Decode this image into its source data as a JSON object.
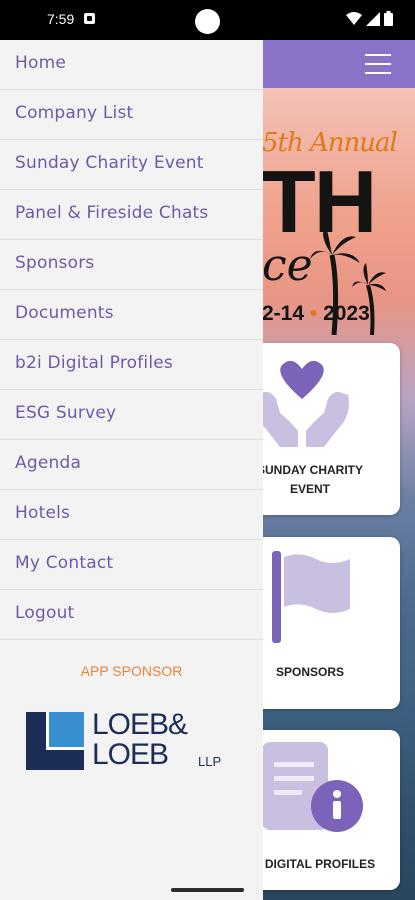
{
  "status_bar": {
    "time": "7:59"
  },
  "drawer": {
    "items": [
      {
        "label": "Home"
      },
      {
        "label": "Company List"
      },
      {
        "label": "Sunday Charity Event"
      },
      {
        "label": "Panel & Fireside Chats"
      },
      {
        "label": "Sponsors"
      },
      {
        "label": "Documents"
      },
      {
        "label": "b2i Digital Profiles"
      },
      {
        "label": "ESG Survey"
      },
      {
        "label": "Agenda"
      },
      {
        "label": "Hotels"
      },
      {
        "label": "My Contact"
      },
      {
        "label": "Logout"
      }
    ],
    "sponsor_label": "APP SPONSOR",
    "sponsor_logo": {
      "line1": "LOEB&",
      "line2": "LOEB",
      "suffix": "LLP"
    }
  },
  "banner": {
    "annual": "5th Annual",
    "big": "TH",
    "script": "ce",
    "dates": "2-14",
    "year": "2023"
  },
  "cards": [
    {
      "label": "SUNDAY CHARITY EVENT",
      "icon": "heart-hands-icon"
    },
    {
      "label": "SPONSORS",
      "icon": "flag-icon"
    },
    {
      "label": "DIGITAL PROFILES",
      "icon": "document-info-icon"
    }
  ],
  "colors": {
    "accent": "#8a72c9",
    "menu_text": "#6e5aa6",
    "sponsor_orange": "#e8833a",
    "logo_navy": "#1c2e58",
    "logo_blue": "#3a8fd0"
  }
}
